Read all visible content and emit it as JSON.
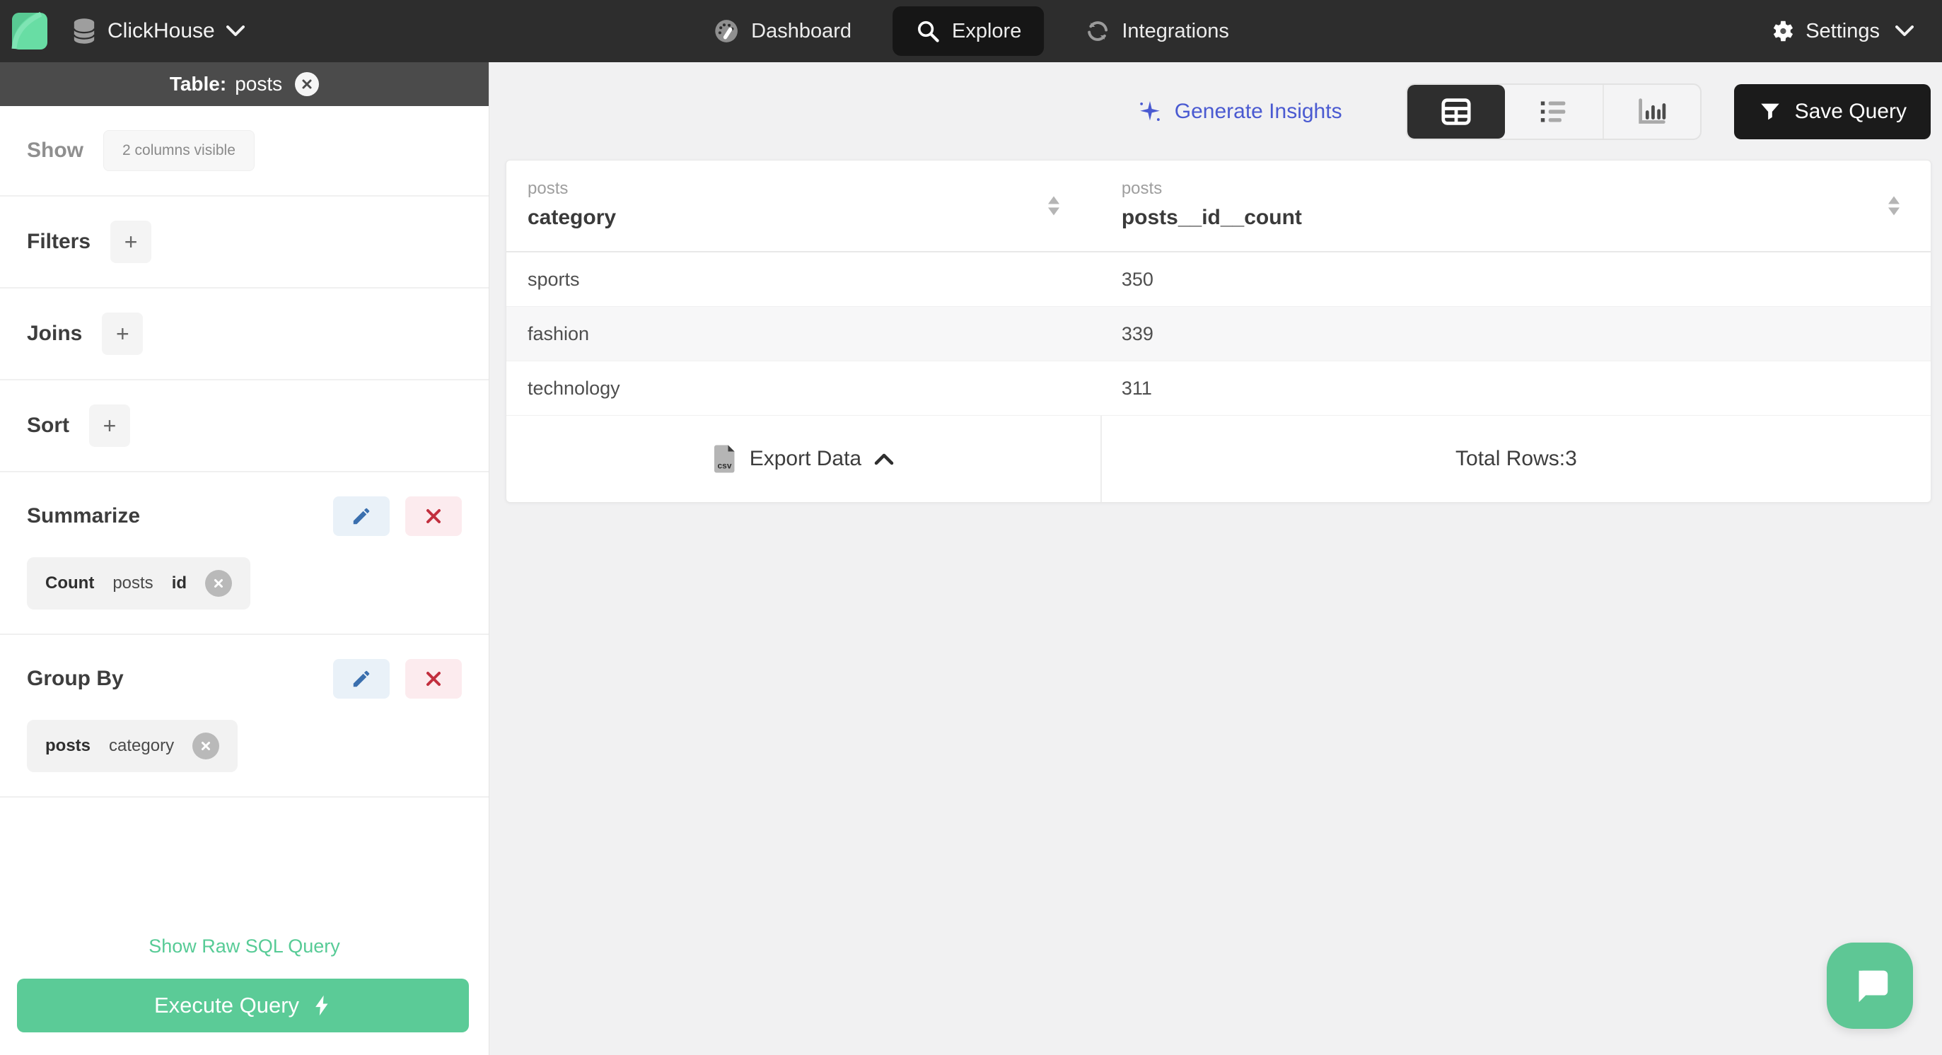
{
  "nav": {
    "connection_label": "ClickHouse",
    "items": [
      {
        "label": "Dashboard"
      },
      {
        "label": "Explore"
      },
      {
        "label": "Integrations"
      }
    ],
    "settings_label": "Settings"
  },
  "sidebar": {
    "table_header": {
      "prefix": "Table:",
      "name": "posts"
    },
    "show": {
      "label": "Show",
      "chip": "2 columns visible"
    },
    "add_label": "+",
    "sections": [
      {
        "label": "Filters"
      },
      {
        "label": "Joins"
      },
      {
        "label": "Sort"
      }
    ],
    "summarize": {
      "label": "Summarize",
      "chip": {
        "agg": "Count",
        "table": "posts",
        "column": "id"
      }
    },
    "group_by": {
      "label": "Group By",
      "chip": {
        "table": "posts",
        "column": "category"
      }
    },
    "raw_sql_link": "Show Raw SQL Query",
    "execute_button": "Execute Query"
  },
  "toolbar": {
    "generate_insights": "Generate Insights",
    "save_query": "Save Query"
  },
  "results": {
    "columns": [
      {
        "table": "posts",
        "name": "category"
      },
      {
        "table": "posts",
        "name": "posts__id__count"
      }
    ],
    "rows": [
      [
        "sports",
        "350"
      ],
      [
        "fashion",
        "339"
      ],
      [
        "technology",
        "311"
      ]
    ],
    "export_label": "Export Data",
    "csv_icon_label": "csv",
    "total_rows_label": "Total Rows:3"
  },
  "colors": {
    "brand_green": "#5bcb97",
    "logo_green": "#68dda4",
    "accent_indigo": "#4a5ad1",
    "nav_bg": "#2d2d2d",
    "sidebar_header_bg": "#4b4b4b",
    "danger_red": "#c22f3e",
    "edit_blue": "#3a6fae",
    "main_bg": "#f1f1f2"
  }
}
